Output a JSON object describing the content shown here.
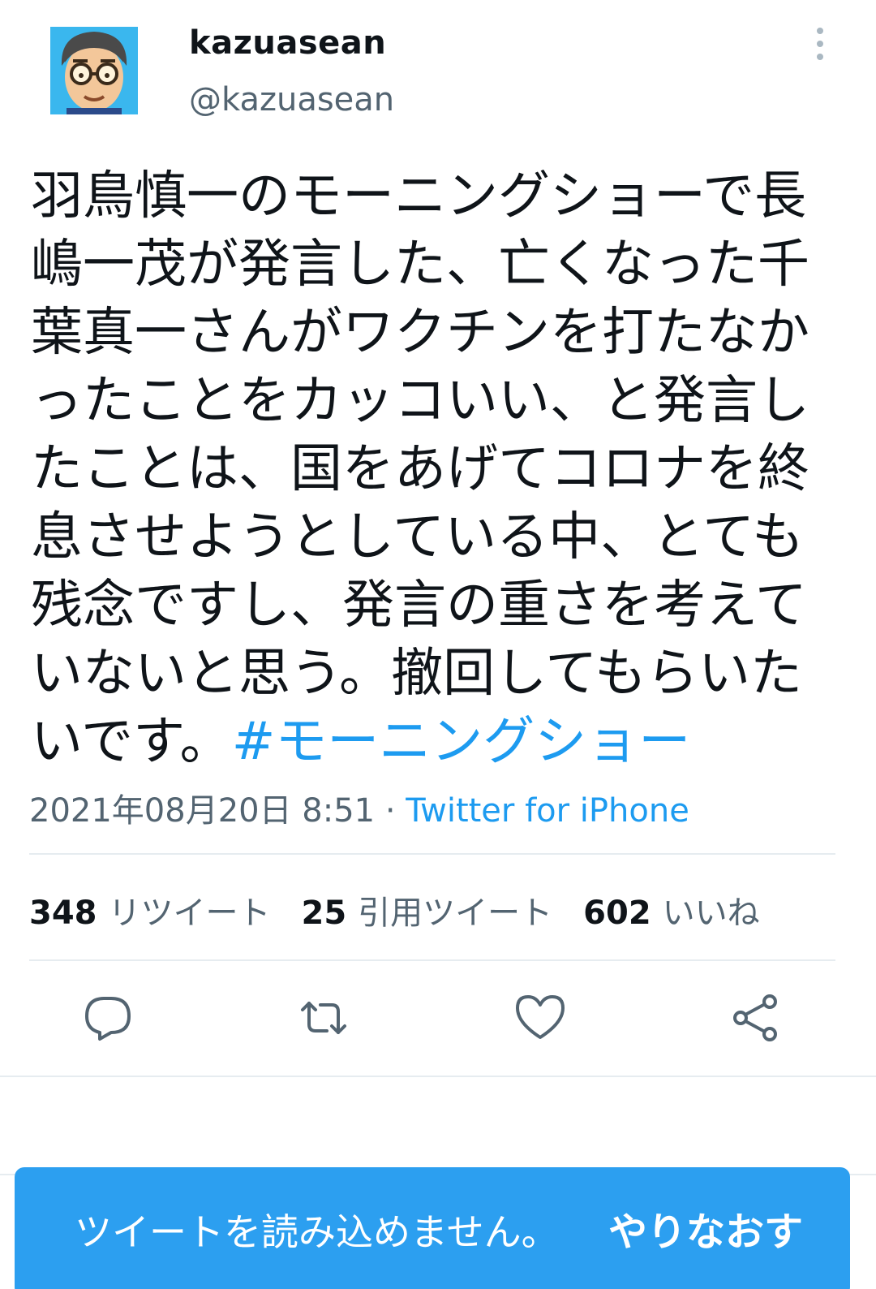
{
  "user": {
    "display_name": "kazuasean",
    "handle": "@kazuasean"
  },
  "tweet": {
    "text": "羽鳥慎一のモーニングショーで長嶋一茂が発言した、亡くなった千葉真一さんがワクチンを打たなかったことをカッコいい、と発言したことは、国をあげてコロナを終息させようとしている中、とても残念ですし、発言の重さを考えていないと思う。撤回してもらいたいです。",
    "hashtag": "#モーニングショー",
    "timestamp": "2021年08月20日 8:51",
    "separator": "·",
    "source": "Twitter for iPhone"
  },
  "stats": {
    "retweets": {
      "count": "348",
      "label": "リツイート"
    },
    "quotes": {
      "count": "25",
      "label": "引用ツイート"
    },
    "likes": {
      "count": "602",
      "label": "いいね"
    }
  },
  "actions": [
    "reply-icon",
    "retweet-icon",
    "like-icon",
    "share-icon"
  ],
  "toast": {
    "message": "ツイートを読み込めません。",
    "retry": "やりなおす"
  },
  "colors": {
    "link": "#1d9bf0",
    "toast_bg": "#2c9ff0",
    "secondary_text": "#536471"
  }
}
